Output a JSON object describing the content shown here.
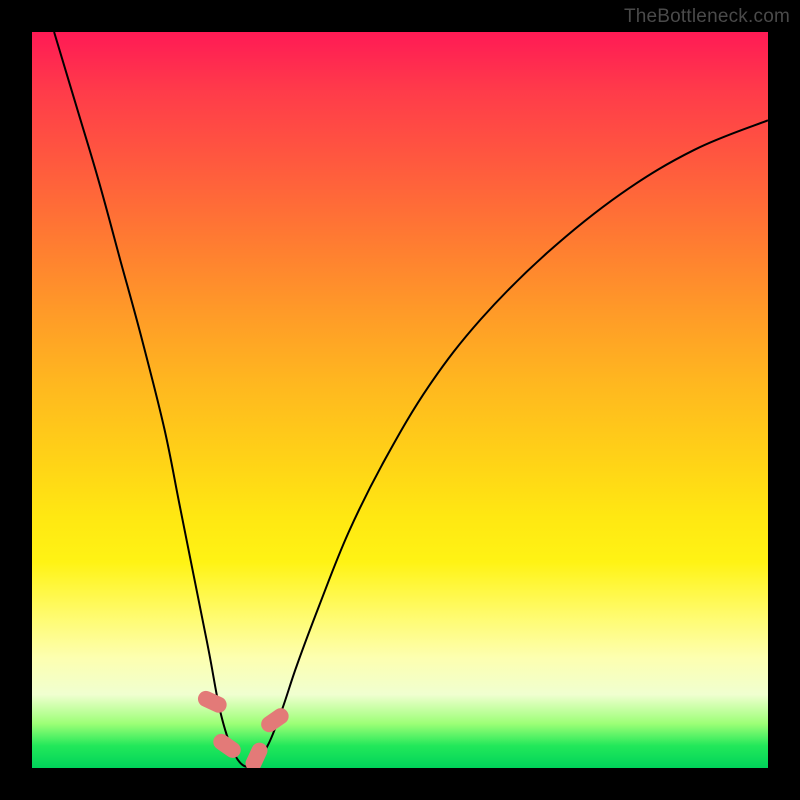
{
  "watermark": "TheBottleneck.com",
  "chart_data": {
    "type": "line",
    "title": "",
    "xlabel": "",
    "ylabel": "",
    "xlim": [
      0,
      100
    ],
    "ylim": [
      0,
      100
    ],
    "series": [
      {
        "name": "bottleneck-curve",
        "x": [
          3,
          6,
          9,
          12,
          15,
          18,
          20,
          22,
          24,
          25.5,
          27,
          28.5,
          30,
          32,
          34,
          36,
          39,
          43,
          48,
          54,
          61,
          70,
          80,
          90,
          100
        ],
        "values": [
          100,
          90,
          80,
          69,
          58,
          46,
          36,
          26,
          16,
          8,
          3,
          0.5,
          0.5,
          3,
          8,
          14,
          22,
          32,
          42,
          52,
          61,
          70,
          78,
          84,
          88
        ]
      }
    ],
    "markers": [
      {
        "x": 24.5,
        "y": 9,
        "rot": -65
      },
      {
        "x": 26.5,
        "y": 3,
        "rot": -55
      },
      {
        "x": 30.5,
        "y": 1.5,
        "rot": 25
      },
      {
        "x": 33.0,
        "y": 6.5,
        "rot": 55
      }
    ],
    "colors": {
      "curve": "#000000",
      "marker": "#e37a78"
    }
  }
}
